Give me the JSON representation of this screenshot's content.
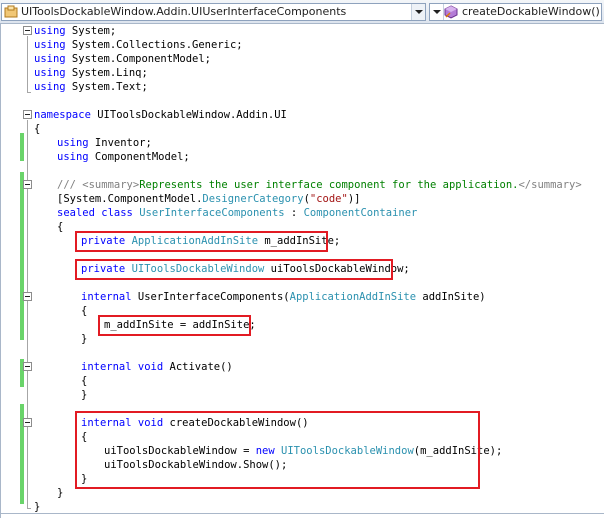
{
  "navbar": {
    "class_dropdown": "UIToolsDockableWindow.Addin.UIUserInterfaceComponents",
    "member_dropdown": "createDockableWindow()",
    "class_icon": "class-icon",
    "member_icon": "method-icon"
  },
  "colors": {
    "keyword": "#0000ff",
    "type": "#2b91af",
    "string": "#a31515",
    "comment": "#008000",
    "doc_tag": "#808080",
    "highlight_box": "#e21b23",
    "change_bar": "#6ad46a"
  },
  "code": {
    "l1": {
      "kw": "using",
      "rest": " System;"
    },
    "l2": {
      "kw": "using",
      "rest": " System.Collections.Generic;"
    },
    "l3": {
      "kw": "using",
      "rest": " System.ComponentModel;"
    },
    "l4": {
      "kw": "using",
      "rest": " System.Linq;"
    },
    "l5": {
      "kw": "using",
      "rest": " System.Text;"
    },
    "l6": {
      "kw": "namespace",
      "rest": " UIToolsDockableWindow.Addin.UI"
    },
    "l7": {
      "text": "{"
    },
    "l8": {
      "kw": "using",
      "rest": " Inventor;"
    },
    "l9": {
      "kw": "using",
      "rest": " ComponentModel;"
    },
    "l10": {
      "doc1": "/// <summary>",
      "comment": "Represents the user interface component for the application.",
      "doc2": "</summary>"
    },
    "l11": {
      "a": "[System.ComponentModel.",
      "ty": "DesignerCategory",
      "b": "(",
      "str": "\"code\"",
      "c": ")]"
    },
    "l12": {
      "kw": "sealed class",
      "sp": " ",
      "ty": "UserInterfaceComponents",
      "b": " : ",
      "ty2": "ComponentContainer"
    },
    "l13": {
      "text": "{"
    },
    "l14": {
      "kw": "private",
      "sp": " ",
      "ty": "ApplicationAddInSite",
      "rest": " m_addInSite;"
    },
    "l15": {
      "kw": "private",
      "sp": " ",
      "ty": "UIToolsDockableWindow",
      "rest": " uiToolsDockableWindow;"
    },
    "l16": {
      "kw": "internal",
      "a": " UserInterfaceComponents(",
      "ty": "ApplicationAddInSite",
      "b": " addInSite)"
    },
    "l17": {
      "text": "{"
    },
    "l18": {
      "text": "m_addInSite = addInSite;"
    },
    "l19": {
      "text": "}"
    },
    "l20": {
      "kw": "internal void",
      "rest": " Activate()"
    },
    "l21": {
      "text": "{"
    },
    "l22": {
      "text": "}"
    },
    "l23": {
      "kw": "internal void",
      "rest": " createDockableWindow()"
    },
    "l24": {
      "text": "{"
    },
    "l25": {
      "a": "uiToolsDockableWindow = ",
      "kw": "new",
      "sp": " ",
      "ty": "UIToolsDockableWindow",
      "b": "(m_addInSite);"
    },
    "l26": {
      "text": "uiToolsDockableWindow.Show();"
    },
    "l27": {
      "text": "}"
    },
    "l28": {
      "text": "}"
    },
    "l29": {
      "text": "}"
    }
  }
}
